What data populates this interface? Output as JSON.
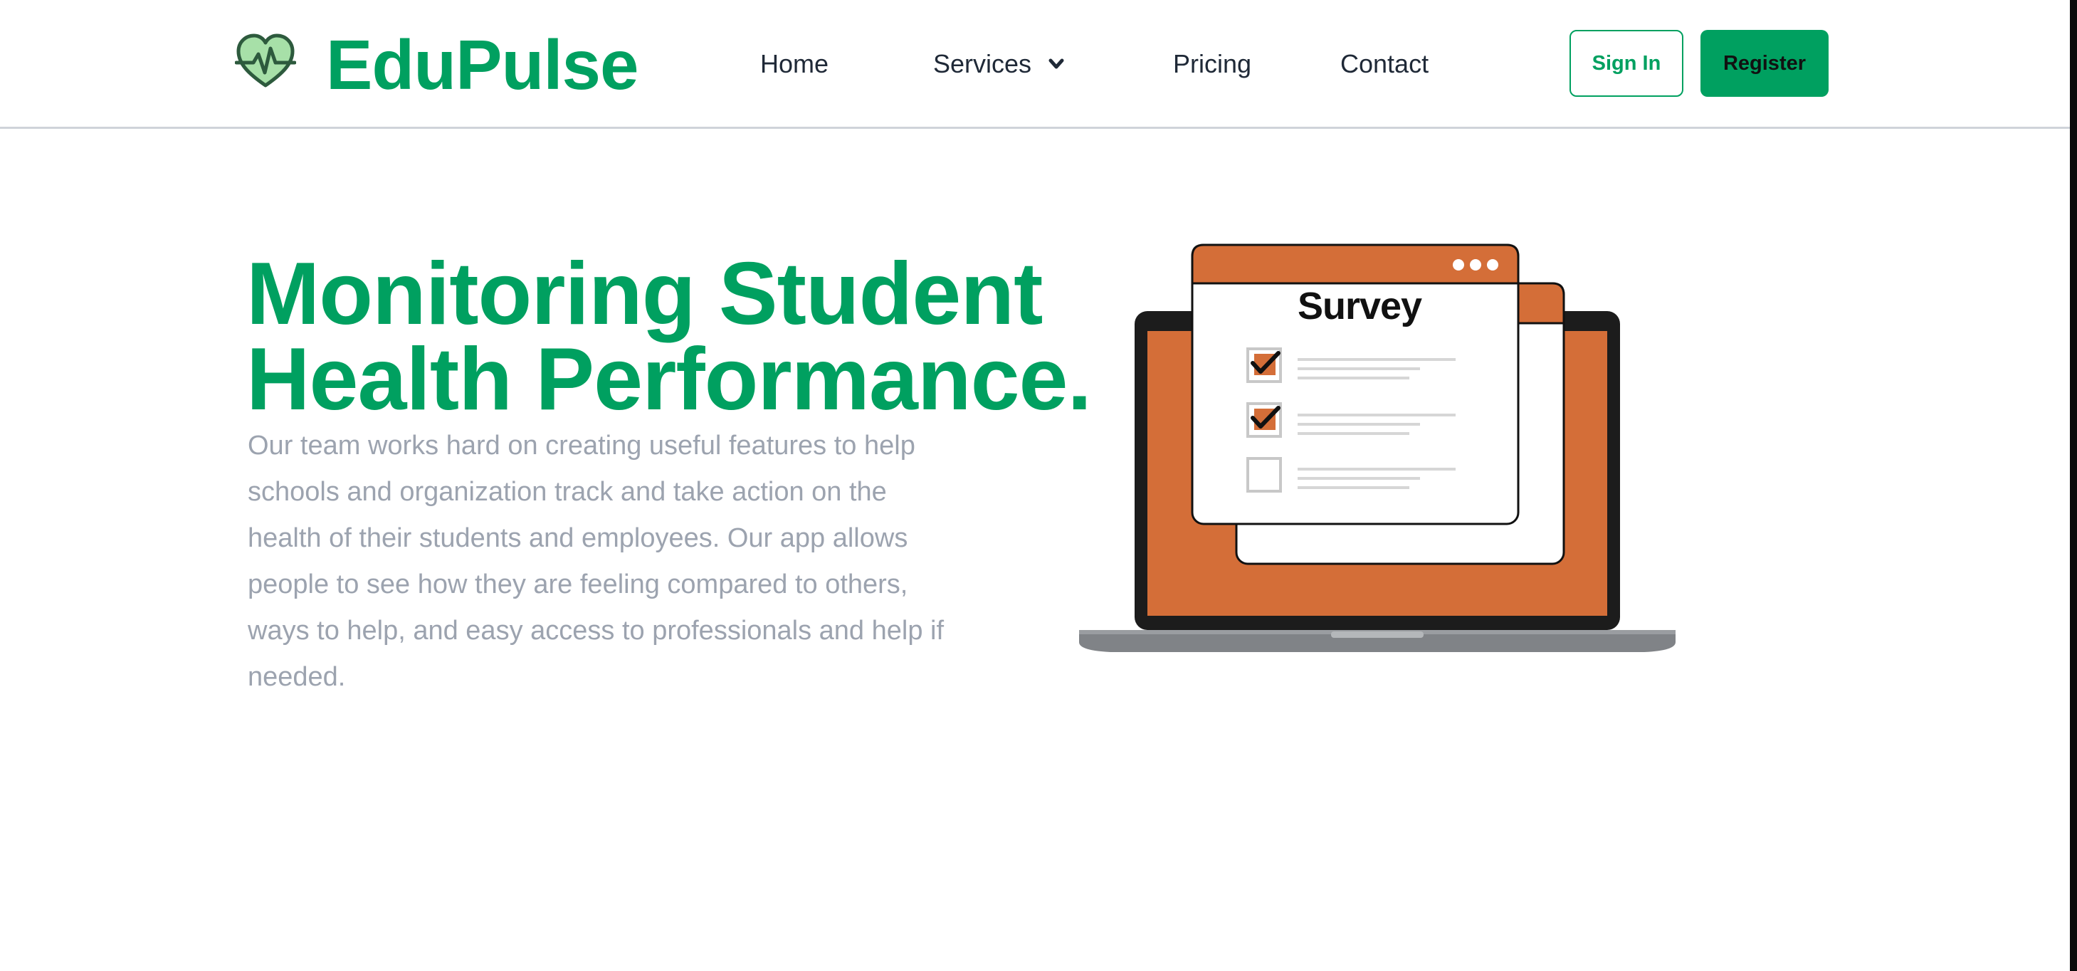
{
  "brand": {
    "name": "EduPulse",
    "logo_icon": "heart-pulse-icon"
  },
  "nav": {
    "items": [
      {
        "label": "Home"
      },
      {
        "label": "Services",
        "icon": "chevron-down-icon"
      },
      {
        "label": "Pricing"
      },
      {
        "label": "Contact"
      }
    ]
  },
  "actions": {
    "signin_label": "Sign In",
    "register_label": "Register"
  },
  "hero": {
    "title_line1": "Monitoring Student",
    "title_line2": "Health Performance.",
    "description": "Our team works hard on creating useful features to help schools and organization track and take action on the health of their students and employees. Our app allows people to see how they are feeling compared to others, ways to help, and easy access to professionals and help if needed."
  },
  "illustration": {
    "survey_title": "Survey",
    "checkboxes": [
      true,
      true,
      false
    ]
  },
  "colors": {
    "brand": "#00A060",
    "accent": "#D46E38",
    "text_dark": "#1F2937",
    "text_muted": "#9CA3AF"
  }
}
